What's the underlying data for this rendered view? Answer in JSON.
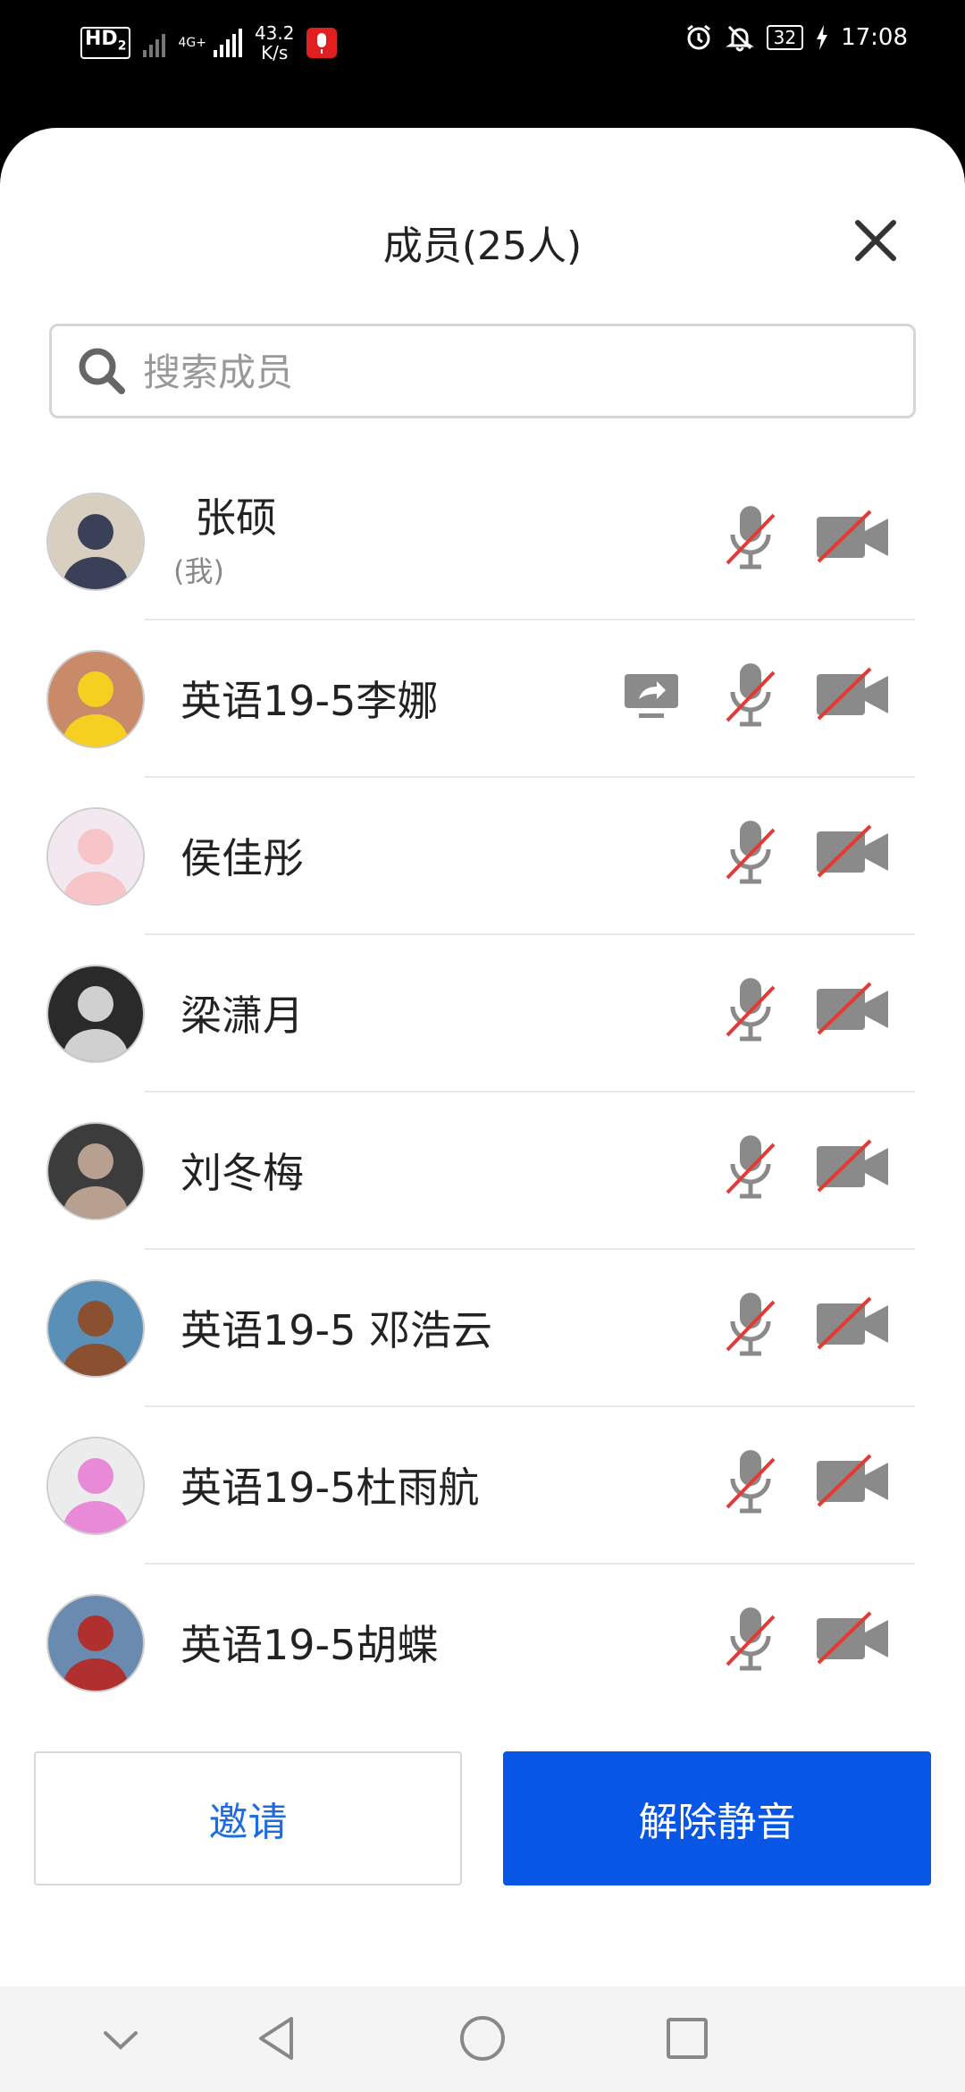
{
  "status_bar": {
    "left": {
      "hd": "HD",
      "hd_sub": "2",
      "network": "4G+",
      "speed_value": "43.2",
      "speed_unit": "K/s"
    },
    "right": {
      "battery": "32",
      "time": "17:08"
    }
  },
  "header": {
    "title": "成员(25人)"
  },
  "search": {
    "placeholder": "搜索成员"
  },
  "members": [
    {
      "name": "张硕",
      "sub": "(我)",
      "mic_muted": true,
      "camera_off": true,
      "screen_sharing": false
    },
    {
      "name": "英语19-5李娜",
      "sub": "",
      "mic_muted": true,
      "camera_off": true,
      "screen_sharing": true
    },
    {
      "name": "侯佳彤",
      "sub": "",
      "mic_muted": true,
      "camera_off": true,
      "screen_sharing": false
    },
    {
      "name": "梁潇月",
      "sub": "",
      "mic_muted": true,
      "camera_off": true,
      "screen_sharing": false
    },
    {
      "name": "刘冬梅",
      "sub": "",
      "mic_muted": true,
      "camera_off": true,
      "screen_sharing": false
    },
    {
      "name": "英语19-5 邓浩云",
      "sub": "",
      "mic_muted": true,
      "camera_off": true,
      "screen_sharing": false
    },
    {
      "name": "英语19-5杜雨航",
      "sub": "",
      "mic_muted": true,
      "camera_off": true,
      "screen_sharing": false
    },
    {
      "name": "英语19-5胡蝶",
      "sub": "",
      "mic_muted": true,
      "camera_off": true,
      "screen_sharing": false
    }
  ],
  "actions": {
    "invite": "邀请",
    "unmute_all": "解除静音"
  },
  "colors": {
    "primary": "#0756e6",
    "invite_text": "#1e6ce0",
    "icon_gray": "#8a8a8a",
    "mute_slash": "#e53935"
  },
  "navbar": {
    "icons": [
      "collapse-chevron-icon",
      "back-triangle-icon",
      "home-circle-icon",
      "recents-square-icon"
    ]
  }
}
